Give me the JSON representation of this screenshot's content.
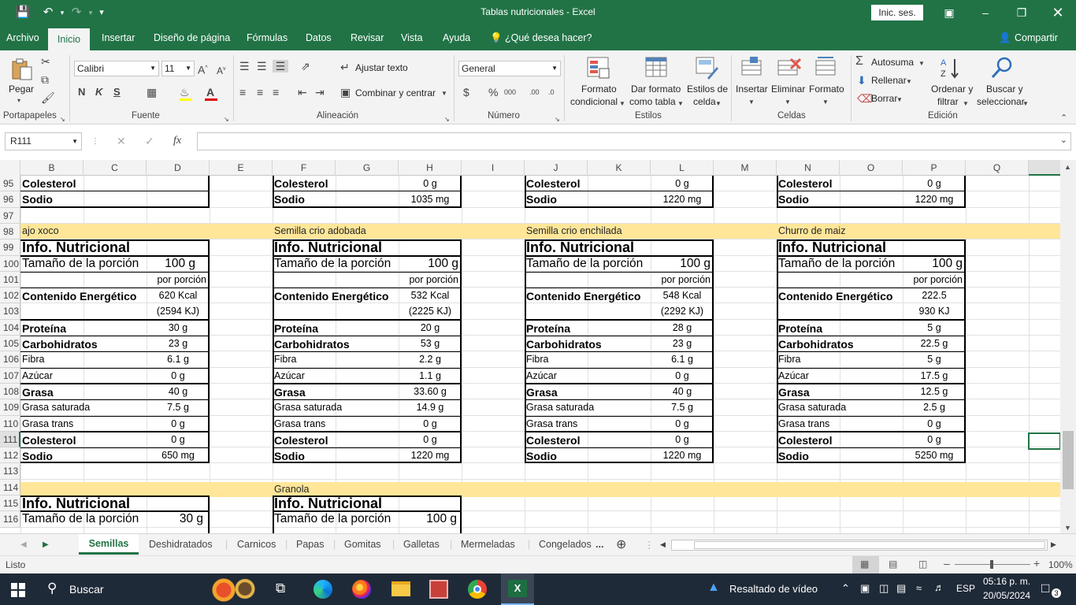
{
  "window": {
    "title": "Tablas nutricionales  -  Excel",
    "signin": "Inic. ses."
  },
  "tabs": {
    "archivo": "Archivo",
    "inicio": "Inicio",
    "insertar": "Insertar",
    "diseno": "Diseño de página",
    "formulas": "Fórmulas",
    "datos": "Datos",
    "revisar": "Revisar",
    "vista": "Vista",
    "ayuda": "Ayuda",
    "tell": "¿Qué desea hacer?",
    "share": "Compartir"
  },
  "ribbon": {
    "pegar": "Pegar",
    "font_name": "Calibri",
    "font_size": "11",
    "ajustar": "Ajustar texto",
    "combinar": "Combinar y centrar",
    "number_format": "General",
    "formato_cond_1": "Formato",
    "formato_cond_2": "condicional",
    "dar_formato_1": "Dar formato",
    "dar_formato_2": "como tabla",
    "estilos_1": "Estilos de",
    "estilos_2": "celda",
    "insertar": "Insertar",
    "eliminar": "Eliminar",
    "formato": "Formato",
    "autosuma": "Autosuma",
    "rellenar": "Rellenar",
    "borrar": "Borrar",
    "ordenar_1": "Ordenar y",
    "ordenar_2": "filtrar",
    "buscar_1": "Buscar y",
    "buscar_2": "seleccionar",
    "groups": {
      "portapapeles": "Portapapeles",
      "fuente": "Fuente",
      "alineacion": "Alineación",
      "numero": "Número",
      "estilos": "Estilos",
      "celdas": "Celdas",
      "edicion": "Edición"
    }
  },
  "formula_bar": {
    "name_box": "R111",
    "fx": "fx",
    "value": ""
  },
  "columns": [
    "B",
    "C",
    "D",
    "E",
    "F",
    "G",
    "H",
    "I",
    "J",
    "K",
    "L",
    "M",
    "N",
    "O",
    "P",
    "Q"
  ],
  "rows": [
    "95",
    "96",
    "97",
    "98",
    "99",
    "100",
    "101",
    "102",
    "103",
    "104",
    "105",
    "106",
    "107",
    "108",
    "109",
    "110",
    "111",
    "112",
    "113",
    "114",
    "115",
    "116"
  ],
  "top_rows": {
    "colesterol": "Colesterol",
    "sodio": "Sodio",
    "col1": {
      "colesterol": "",
      "sodio": ""
    },
    "col2": {
      "colesterol": "0 g",
      "sodio": "1035 mg"
    },
    "col3": {
      "colesterol": "0 g",
      "sodio": "1220 mg"
    },
    "col4": {
      "colesterol": "0 g",
      "sodio": "1220 mg"
    }
  },
  "labels": {
    "info": "Info. Nutricional",
    "tam": "Tamaño de la porción",
    "porcion": "por porción",
    "energia": "Contenido Energético",
    "proteina": "Proteína",
    "carbo": "Carbohidratos",
    "fibra": "Fibra",
    "azucar": "Azúcar",
    "grasa": "Grasa",
    "saturada": "Grasa saturada",
    "trans": "Grasa trans",
    "colesterol": "Colesterol",
    "sodio": "Sodio"
  },
  "panels": [
    {
      "name": "ajo xoco",
      "size": "100 g",
      "kcal": "620 Kcal",
      "kj": "(2594 KJ)",
      "proteina": "30 g",
      "carbo": "23 g",
      "fibra": "6.1 g",
      "azucar": "0 g",
      "grasa": "40 g",
      "saturada": "7.5 g",
      "trans": "0 g",
      "colesterol": "0 g",
      "sodio": "650 mg"
    },
    {
      "name": "Semilla crio adobada",
      "size": "100 g",
      "kcal": "532 Kcal",
      "kj": "(2225 KJ)",
      "proteina": "20 g",
      "carbo": "53 g",
      "fibra": "2.2 g",
      "azucar": "1.1 g",
      "grasa": "33.60 g",
      "saturada": "14.9 g",
      "trans": "0 g",
      "colesterol": "0 g",
      "sodio": "1220 mg"
    },
    {
      "name": "Semilla crio enchilada",
      "size": "100 g",
      "kcal": "548 Kcal",
      "kj": "(2292 KJ)",
      "proteina": "28 g",
      "carbo": "23 g",
      "fibra": "6.1 g",
      "azucar": "0 g",
      "grasa": "40 g",
      "saturada": "7.5 g",
      "trans": "0 g",
      "colesterol": "0 g",
      "sodio": "1220 mg"
    },
    {
      "name": "Churro de maiz",
      "size": "100 g",
      "kcal": "222.5",
      "kj": "930 KJ",
      "proteina": "5 g",
      "carbo": "22.5 g",
      "fibra": "5 g",
      "azucar": "17.5 g",
      "grasa": "12.5 g",
      "saturada": "2.5 g",
      "trans": "0 g",
      "colesterol": "0 g",
      "sodio": "5250 mg"
    }
  ],
  "bottom": {
    "granola": "Granola",
    "p1_size": "30 g",
    "p2_size": "100 g"
  },
  "sheets": [
    "Semillas",
    "Deshidratados",
    "Carnicos",
    "Papas",
    "Gomitas",
    "Galletas",
    "Mermeladas",
    "Congelados"
  ],
  "sheets_more": "...",
  "status": {
    "ready": "Listo",
    "zoom": "100%"
  },
  "taskbar": {
    "search": "Buscar",
    "video": "Resaltado de vídeo",
    "lang": "ESP",
    "time": "05:16 p. m.",
    "date": "20/05/2024",
    "notif": "3"
  }
}
